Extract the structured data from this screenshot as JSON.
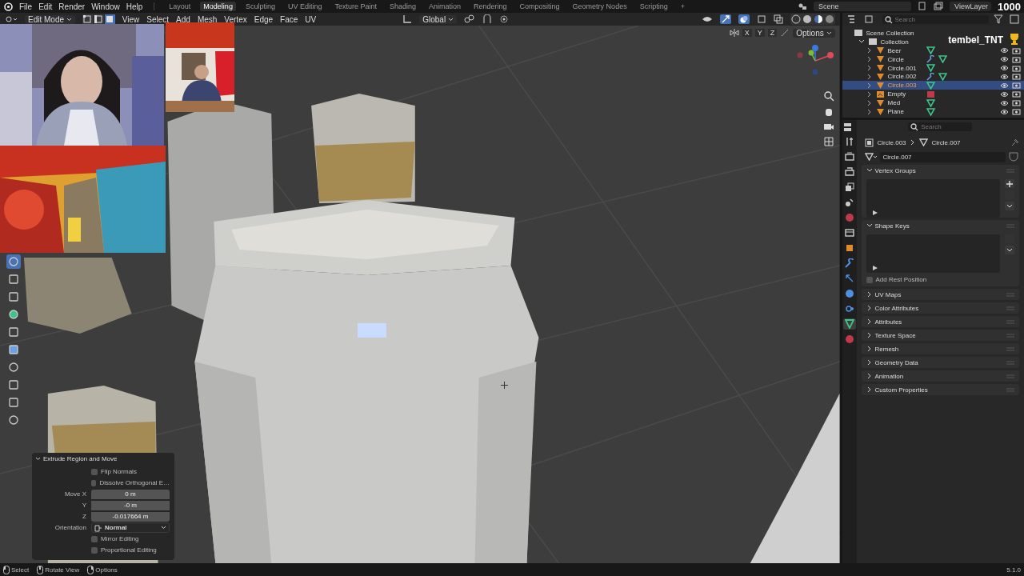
{
  "topbar": {
    "menus": [
      "File",
      "Edit",
      "Render",
      "Window",
      "Help"
    ],
    "workspaces": [
      {
        "label": "Layout",
        "selected": false
      },
      {
        "label": "Modeling",
        "selected": true
      },
      {
        "label": "Sculpting",
        "selected": false
      },
      {
        "label": "UV Editing",
        "selected": false
      },
      {
        "label": "Texture Paint",
        "selected": false
      },
      {
        "label": "Shading",
        "selected": false
      },
      {
        "label": "Animation",
        "selected": false
      },
      {
        "label": "Rendering",
        "selected": false
      },
      {
        "label": "Compositing",
        "selected": false
      },
      {
        "label": "Geometry Nodes",
        "selected": false
      },
      {
        "label": "Scripting",
        "selected": false
      }
    ],
    "add_tab": "+",
    "scene": "Scene",
    "view_layer": "ViewLayer"
  },
  "stream_overlay": {
    "username": "tembel_TNT",
    "counter": "1000"
  },
  "viewport_header": {
    "mode": "Edit Mode",
    "select_modes": [
      {
        "kind": "vertex",
        "selected": false
      },
      {
        "kind": "edge",
        "selected": false
      },
      {
        "kind": "face",
        "selected": true
      }
    ],
    "menus": [
      "View",
      "Select",
      "Add",
      "Mesh",
      "Vertex",
      "Edge",
      "Face",
      "UV"
    ],
    "orientation": "Global",
    "axes": [
      "X",
      "Y",
      "Z"
    ],
    "options": "Options"
  },
  "operator_panel": {
    "title": "Extrude Region and Move",
    "expanded": true,
    "rows": [
      {
        "kind": "checkbox",
        "label": "Flip Normals",
        "checked": false
      },
      {
        "kind": "checkbox",
        "label": "Dissolve Orthogonal E…",
        "checked": false
      },
      {
        "kind": "number",
        "label": "Move X",
        "value": "0 m"
      },
      {
        "kind": "number",
        "label": "Y",
        "value": "-0 m"
      },
      {
        "kind": "number",
        "label": "Z",
        "value": "-0.017664 m"
      },
      {
        "kind": "dropdown",
        "label": "Orientation",
        "value": "Normal"
      },
      {
        "kind": "checkbox",
        "label": "Mirror Editing",
        "checked": false
      },
      {
        "kind": "checkbox",
        "label": "Proportional Editing",
        "checked": false
      }
    ]
  },
  "outliner": {
    "search": {
      "placeholder": "Search"
    },
    "root": "Scene Collection",
    "collection": {
      "name": "Collection",
      "expanded": true,
      "children": [
        {
          "name": "Beer",
          "kind": "mesh",
          "selected": false,
          "modifier": false
        },
        {
          "name": "Circle",
          "kind": "mesh",
          "selected": false,
          "modifier": true
        },
        {
          "name": "Circle.001",
          "kind": "mesh",
          "selected": false,
          "modifier": false
        },
        {
          "name": "Circle.002",
          "kind": "mesh",
          "selected": false,
          "modifier": true
        },
        {
          "name": "Circle.003",
          "kind": "mesh",
          "selected": true,
          "modifier": false
        },
        {
          "name": "Empty",
          "kind": "empty",
          "selected": false,
          "modifier": false
        },
        {
          "name": "Med",
          "kind": "mesh",
          "selected": false,
          "modifier": false
        },
        {
          "name": "Plane",
          "kind": "mesh",
          "selected": false,
          "modifier": false
        }
      ]
    }
  },
  "properties": {
    "search": {
      "placeholder": "Search"
    },
    "tabs": [
      {
        "kind": "tool",
        "selected": false
      },
      {
        "kind": "render",
        "selected": false
      },
      {
        "kind": "output",
        "selected": false
      },
      {
        "kind": "view_layer",
        "selected": false
      },
      {
        "kind": "scene",
        "selected": false
      },
      {
        "kind": "world",
        "selected": false
      },
      {
        "kind": "collection",
        "selected": false
      },
      {
        "kind": "object",
        "selected": false
      },
      {
        "kind": "modifier",
        "selected": false
      },
      {
        "kind": "particles",
        "selected": false
      },
      {
        "kind": "physics",
        "selected": false
      },
      {
        "kind": "constraints",
        "selected": false
      },
      {
        "kind": "data",
        "selected": true
      },
      {
        "kind": "material",
        "selected": false
      }
    ],
    "breadcrumb": [
      "Circle.003",
      "Circle.007"
    ],
    "data_name": "Circle.007",
    "panels": [
      {
        "title": "Vertex Groups",
        "expanded": true,
        "kind": "list"
      },
      {
        "title": "Shape Keys",
        "expanded": true,
        "kind": "list",
        "checkbox": {
          "label": "Add Rest Position",
          "checked": false
        }
      },
      {
        "title": "UV Maps",
        "expanded": false,
        "kind": "plain"
      },
      {
        "title": "Color Attributes",
        "expanded": false,
        "kind": "plain"
      },
      {
        "title": "Attributes",
        "expanded": false,
        "kind": "plain"
      },
      {
        "title": "Texture Space",
        "expanded": false,
        "kind": "plain"
      },
      {
        "title": "Remesh",
        "expanded": false,
        "kind": "plain"
      },
      {
        "title": "Geometry Data",
        "expanded": false,
        "kind": "plain"
      },
      {
        "title": "Animation",
        "expanded": false,
        "kind": "plain"
      },
      {
        "title": "Custom Properties",
        "expanded": false,
        "kind": "plain"
      }
    ]
  },
  "status_bar": {
    "items": [
      "Select",
      "Rotate View",
      "Options"
    ],
    "version": "5.1.0"
  }
}
